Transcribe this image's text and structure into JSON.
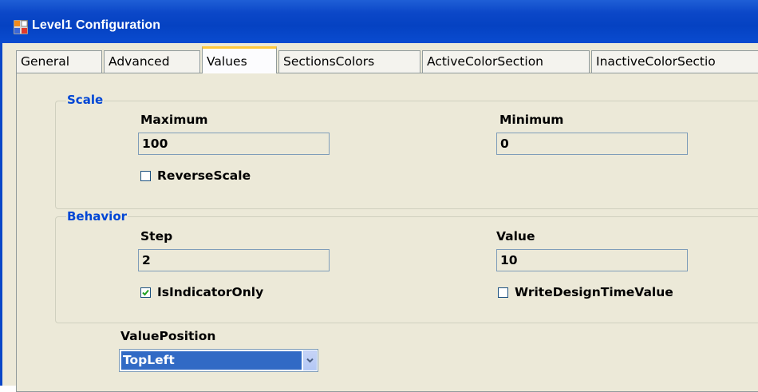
{
  "window": {
    "title": "Level1 Configuration"
  },
  "tabs": [
    {
      "label": "General",
      "active": false
    },
    {
      "label": "Advanced",
      "active": false
    },
    {
      "label": "Values",
      "active": true
    },
    {
      "label": "SectionsColors",
      "active": false
    },
    {
      "label": "ActiveColorSection",
      "active": false
    },
    {
      "label": "InactiveColorSectio",
      "active": false
    }
  ],
  "scale": {
    "group_label": "Scale",
    "maximum_label": "Maximum",
    "maximum_value": "100",
    "minimum_label": "Minimum",
    "minimum_value": "0",
    "reverse_scale_label": "ReverseScale",
    "reverse_scale_checked": false
  },
  "behavior": {
    "group_label": "Behavior",
    "step_label": "Step",
    "step_value": "2",
    "value_label": "Value",
    "value_value": "10",
    "is_indicator_only_label": "IsIndicatorOnly",
    "is_indicator_only_checked": true,
    "write_design_time_label": "WriteDesignTimeValue",
    "write_design_time_checked": false
  },
  "value_position": {
    "label": "ValuePosition",
    "selected": "TopLeft"
  },
  "colors": {
    "title_bar": "#0542c2",
    "group_label": "#0046d5",
    "selection": "#316ac5",
    "checkmark": "#21a121"
  }
}
